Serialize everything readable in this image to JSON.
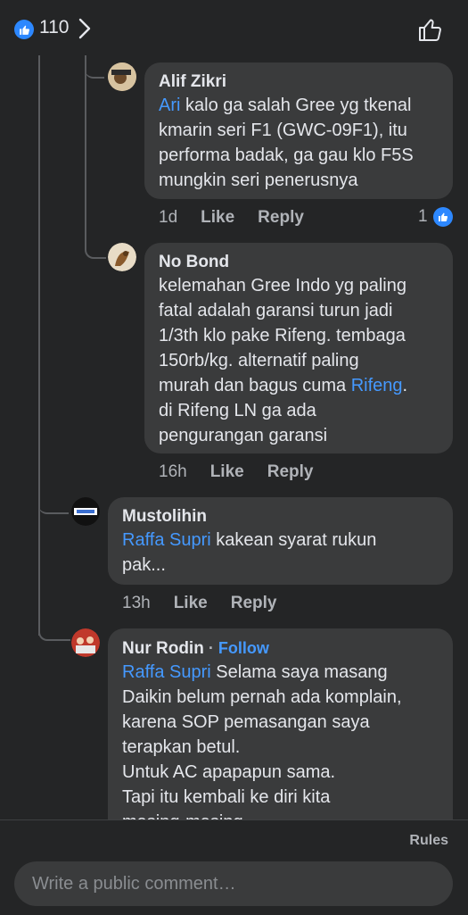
{
  "header": {
    "like_count": "110",
    "like_icon": "like-reaction-icon",
    "chevron_icon": "chevron-right-icon",
    "thumb_icon": "thumbs-up-outline-icon"
  },
  "comments": [
    {
      "name": "Alif Zikri",
      "mention": "Ari",
      "text_lines": [
        " kalo ga salah Gree yg tkenal",
        "kmarin seri F1 (GWC-09F1), itu",
        "performa badak, ga gau klo F5S",
        "mungkin seri penerusnya"
      ],
      "time": "1d",
      "like": "Like",
      "reply": "Reply",
      "reaction_count": "1"
    },
    {
      "name": "No Bond",
      "text_lines": [
        "kelemahan Gree Indo yg paling",
        "fatal adalah garansi turun jadi",
        "1/3th klo pake Rifeng. tembaga",
        "150rb/kg. alternatif paling"
      ],
      "line5_before": "murah dan bagus cuma ",
      "line5_mention": "Rifeng",
      "line5_after": ".",
      "text_lines2": [
        "di Rifeng LN ga ada",
        "pengurangan garansi"
      ],
      "time": "16h",
      "like": "Like",
      "reply": "Reply"
    },
    {
      "name": "Mustolihin",
      "mention": "Raffa Supri",
      "line1_after": " kakean syarat rukun",
      "line2": "pak...",
      "time": "13h",
      "like": "Like",
      "reply": "Reply"
    },
    {
      "name": "Nur Rodin",
      "dot": " · ",
      "follow": "Follow",
      "mention": "Raffa Supri",
      "line1_after": "  Selama saya masang",
      "text_lines": [
        "Daikin belum pernah ada komplain,",
        "karena SOP pemasangan saya",
        "terapkan betul.",
        "Untuk AC apapapun sama.",
        "Tapi itu kembali ke diri kita",
        "masing-masing"
      ]
    }
  ],
  "footer": {
    "rules": "Rules",
    "comment_placeholder": "Write a public comment…"
  }
}
